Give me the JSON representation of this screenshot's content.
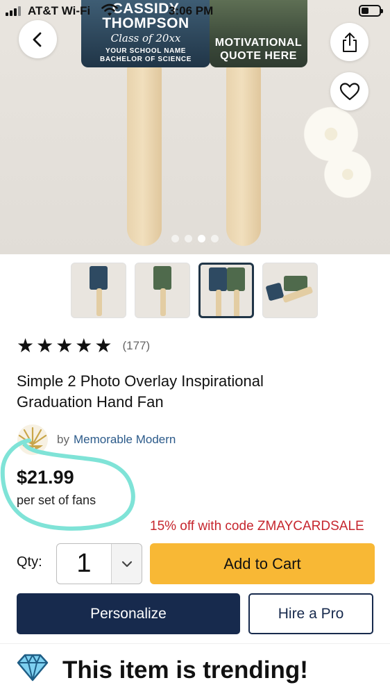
{
  "status_bar": {
    "carrier": "AT&T Wi-Fi",
    "time": "3:06 PM"
  },
  "hero": {
    "card1": {
      "name_line1": "CASSIDY",
      "name_line2": "THOMPSON",
      "class_year": "Class of 20xx",
      "school": "YOUR SCHOOL NAME",
      "degree": "BACHELOR OF SCIENCE"
    },
    "card2": {
      "quote_line1": "MOTIVATIONAL",
      "quote_line2": "QUOTE HERE"
    },
    "image_count": 4,
    "active_image_index": 2
  },
  "thumbnails": {
    "count": 4,
    "active_index": 2
  },
  "rating": {
    "stars_glyphs": "★★★★★",
    "value": 5,
    "count": "(177)"
  },
  "product": {
    "title_line1": "Simple 2 Photo Overlay Inspirational",
    "title_line2": "Graduation Hand Fan",
    "by": "by",
    "seller": "Memorable Modern",
    "price": "$21.99",
    "price_unit": "per set of fans",
    "promo": "15% off with code ZMAYCARDSALE"
  },
  "purchase": {
    "qty_label": "Qty:",
    "qty_value": "1",
    "add_to_cart": "Add to Cart",
    "personalize": "Personalize",
    "hire_pro": "Hire a Pro"
  },
  "trending": {
    "text": "This item is trending!"
  },
  "colors": {
    "navy": "#172a4d",
    "cart_yellow": "#f8b835",
    "promo_red": "#c6262e",
    "highlight_teal": "#7fe3d7",
    "seller_blue": "#2b5a8a"
  },
  "icons": [
    "back-arrow-icon",
    "share-icon",
    "heart-icon",
    "chevron-down-icon",
    "diamond-icon",
    "wifi-icon",
    "battery-icon",
    "signal-icon"
  ]
}
